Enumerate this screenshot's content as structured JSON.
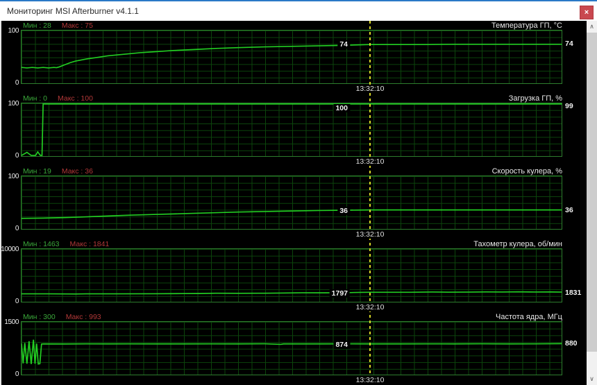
{
  "window": {
    "title": "Мониторинг MSI Afterburner v4.1.1",
    "close_glyph": "×"
  },
  "scrollbar": {
    "up_glyph": "∧",
    "down_glyph": "∨"
  },
  "colors": {
    "accent_blue": "#2a79c7",
    "close_bg": "#c9484f",
    "plot_line": "#22cd22",
    "grid_line": "#0c450c",
    "plot_border": "#2e7d2e",
    "cursor_line": "#d9d926",
    "min_color": "#3aa83a",
    "max_color": "#b23838"
  },
  "chart_data": [
    {
      "type": "line",
      "title": "Температура ГП, °C",
      "min_text": "Мин : 28",
      "max_text": "Макс : 75",
      "ylim": [
        0,
        100
      ],
      "y_top_label": "100",
      "y_bottom_label": "0",
      "cursor_value": "74",
      "end_value": "74",
      "timestamp": "13:32:10",
      "series": [
        [
          0,
          30
        ],
        [
          1,
          29
        ],
        [
          2,
          30
        ],
        [
          3,
          29
        ],
        [
          4,
          30
        ],
        [
          5,
          29
        ],
        [
          6,
          30
        ],
        [
          6.5,
          29.5
        ],
        [
          7,
          31
        ],
        [
          8,
          35
        ],
        [
          9,
          39
        ],
        [
          10,
          42
        ],
        [
          12,
          46
        ],
        [
          14,
          49
        ],
        [
          16,
          52
        ],
        [
          19,
          55
        ],
        [
          22,
          58
        ],
        [
          25,
          60
        ],
        [
          28,
          62
        ],
        [
          32,
          64
        ],
        [
          36,
          66
        ],
        [
          40,
          67.5
        ],
        [
          45,
          69
        ],
        [
          50,
          70
        ],
        [
          55,
          71
        ],
        [
          60,
          72
        ],
        [
          64.5,
          73.5
        ],
        [
          70,
          73.5
        ],
        [
          75,
          73.5
        ],
        [
          80,
          74
        ],
        [
          85,
          74
        ],
        [
          90,
          74
        ],
        [
          95,
          74
        ],
        [
          100,
          74
        ]
      ]
    },
    {
      "type": "line",
      "title": "Загрузка ГП, %",
      "min_text": "Мин : 0",
      "max_text": "Макс : 100",
      "ylim": [
        0,
        100
      ],
      "y_top_label": "100",
      "y_bottom_label": "0",
      "cursor_value": "100",
      "end_value": "99",
      "timestamp": "13:32:10",
      "series": [
        [
          0,
          0
        ],
        [
          1,
          7
        ],
        [
          1.8,
          0
        ],
        [
          2.6,
          0
        ],
        [
          3,
          8
        ],
        [
          3.5,
          0
        ],
        [
          3.8,
          0
        ],
        [
          4,
          100
        ],
        [
          20,
          100
        ],
        [
          40,
          100
        ],
        [
          64.5,
          100
        ],
        [
          80,
          100
        ],
        [
          99,
          100
        ],
        [
          100,
          99
        ]
      ]
    },
    {
      "type": "line",
      "title": "Скорость кулера, %",
      "min_text": "Мин : 19",
      "max_text": "Макс : 36",
      "ylim": [
        0,
        100
      ],
      "y_top_label": "100",
      "y_bottom_label": "0",
      "cursor_value": "36",
      "end_value": "36",
      "timestamp": "13:32:10",
      "series": [
        [
          0,
          20
        ],
        [
          4,
          20.5
        ],
        [
          8,
          21.5
        ],
        [
          12,
          23
        ],
        [
          16,
          24.5
        ],
        [
          20,
          26
        ],
        [
          25,
          27.5
        ],
        [
          30,
          29
        ],
        [
          35,
          30.5
        ],
        [
          40,
          32
        ],
        [
          45,
          33
        ],
        [
          50,
          34
        ],
        [
          55,
          35
        ],
        [
          60,
          35.5
        ],
        [
          64.5,
          36
        ],
        [
          70,
          36
        ],
        [
          75,
          36
        ],
        [
          80,
          36
        ],
        [
          85,
          36
        ],
        [
          90,
          36
        ],
        [
          95,
          36
        ],
        [
          100,
          36
        ]
      ]
    },
    {
      "type": "line",
      "title": "Тахометр кулера, об/мин",
      "min_text": "Мин : 1463",
      "max_text": "Макс : 1841",
      "ylim": [
        0,
        10000
      ],
      "y_top_label": "10000",
      "y_bottom_label": "0",
      "cursor_value": "1797",
      "end_value": "1831",
      "timestamp": "13:32:10",
      "series": [
        [
          0,
          1500
        ],
        [
          5,
          1495
        ],
        [
          10,
          1470
        ],
        [
          12,
          1500
        ],
        [
          18,
          1505
        ],
        [
          25,
          1530
        ],
        [
          30,
          1545
        ],
        [
          33,
          1560
        ],
        [
          36,
          1620
        ],
        [
          40,
          1600
        ],
        [
          44,
          1610
        ],
        [
          48,
          1650
        ],
        [
          52,
          1700
        ],
        [
          56,
          1690
        ],
        [
          60,
          1720
        ],
        [
          63,
          1780
        ],
        [
          64.5,
          1797
        ],
        [
          68,
          1790
        ],
        [
          72,
          1800
        ],
        [
          76,
          1850
        ],
        [
          79,
          1820
        ],
        [
          83,
          1830
        ],
        [
          86,
          1870
        ],
        [
          89,
          1840
        ],
        [
          92,
          1880
        ],
        [
          95,
          1850
        ],
        [
          98,
          1860
        ],
        [
          100,
          1831
        ]
      ]
    },
    {
      "type": "line",
      "title": "Частота ядра, МГц",
      "min_text": "Мин : 300",
      "max_text": "Макс : 993",
      "ylim": [
        0,
        1500
      ],
      "y_top_label": "1500",
      "y_bottom_label": "0",
      "cursor_value": "874",
      "end_value": "880",
      "timestamp": "13:32:10",
      "series": [
        [
          0,
          880
        ],
        [
          0.3,
          320
        ],
        [
          0.6,
          900
        ],
        [
          1.0,
          310
        ],
        [
          1.4,
          950
        ],
        [
          1.8,
          300
        ],
        [
          2.2,
          993
        ],
        [
          2.5,
          310
        ],
        [
          2.8,
          880
        ],
        [
          3.1,
          300
        ],
        [
          3.4,
          310
        ],
        [
          3.7,
          870
        ],
        [
          4,
          874
        ],
        [
          8,
          872
        ],
        [
          12,
          875
        ],
        [
          16,
          873
        ],
        [
          20,
          875
        ],
        [
          25,
          874
        ],
        [
          30,
          873
        ],
        [
          35,
          875
        ],
        [
          40,
          874
        ],
        [
          45,
          876
        ],
        [
          48,
          860
        ],
        [
          48.5,
          874
        ],
        [
          50,
          874
        ],
        [
          55,
          873
        ],
        [
          60,
          875
        ],
        [
          64.5,
          874
        ],
        [
          70,
          873
        ],
        [
          75,
          875
        ],
        [
          80,
          874
        ],
        [
          85,
          876
        ],
        [
          90,
          874
        ],
        [
          95,
          875
        ],
        [
          100,
          880
        ]
      ]
    }
  ]
}
